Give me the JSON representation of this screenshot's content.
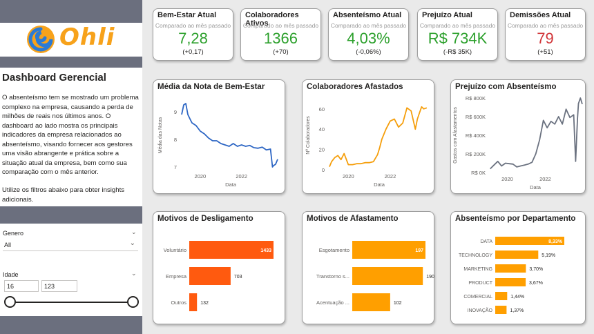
{
  "sidebar": {
    "logo_text": "Ohli",
    "title": "Dashboard Gerencial",
    "description": "O absenteísmo tem se mostrado um problema complexo na empresa, causando a perda de milhões de reais nos últimos anos. O dashboard ao lado mostra os principais indicadores da empresa relacionados ao absenteísmo, visando fornecer aos gestores uma visão abrangente e prática sobre a situação atual da empresa, bem como sua comparação com o mês anterior.",
    "hint": "Utilize os filtros abaixo para obter insights adicionais.",
    "colors": {
      "band": "#6b6f7e",
      "logo_orange": "#f7a21b",
      "logo_blue": "#2b7bd6"
    }
  },
  "filters": {
    "genero": {
      "label": "Genero",
      "value": "All"
    },
    "idade": {
      "label": "Idade",
      "min": "16",
      "max": "123"
    }
  },
  "kpis": [
    {
      "title": "Bem-Estar Atual",
      "subtitle": "Comparado ao mês passado",
      "value": "7,28",
      "delta": "(+0,17)",
      "color": "#2ca02c"
    },
    {
      "title": "Colaboradores Ativos",
      "subtitle": "Comparado ao mês passado",
      "value": "1366",
      "delta": "(+70)",
      "color": "#2ca02c"
    },
    {
      "title": "Absenteísmo Atual",
      "subtitle": "Comparado ao mês passado",
      "value": "4,03%",
      "delta": "(-0,06%)",
      "color": "#2ca02c"
    },
    {
      "title": "Prejuízo Atual",
      "subtitle": "Comparado ao mês passado",
      "value": "R$ 734K",
      "delta": "(-R$ 35K)",
      "color": "#2ca02c"
    },
    {
      "title": "Demissões Atual",
      "subtitle": "Comparado ao mês passado",
      "value": "79",
      "delta": "(+51)",
      "color": "#d13438"
    }
  ],
  "chart_data": [
    {
      "type": "line",
      "title": "Média da Nota de Bem-Estar",
      "xlabel": "Data",
      "ylabel": "Média das Notas",
      "color": "#2d66c4",
      "xlim": [
        2019.0,
        2023.95
      ],
      "ylim": [
        6.9,
        9.4
      ],
      "x_ticks": [
        2020,
        2022
      ],
      "y_ticks": [
        7,
        8,
        9
      ],
      "x": [
        2019.1,
        2019.2,
        2019.3,
        2019.4,
        2019.5,
        2019.6,
        2019.8,
        2020.0,
        2020.2,
        2020.4,
        2020.6,
        2020.8,
        2021.0,
        2021.2,
        2021.4,
        2021.6,
        2021.8,
        2022.0,
        2022.2,
        2022.4,
        2022.6,
        2022.8,
        2023.0,
        2023.2,
        2023.4,
        2023.5,
        2023.55,
        2023.65,
        2023.75
      ],
      "y": [
        8.9,
        9.25,
        9.3,
        8.9,
        8.75,
        8.6,
        8.5,
        8.3,
        8.2,
        8.05,
        7.95,
        7.95,
        7.85,
        7.8,
        7.75,
        7.85,
        7.75,
        7.8,
        7.75,
        7.78,
        7.7,
        7.68,
        7.72,
        7.62,
        7.65,
        7.0,
        7.05,
        7.1,
        7.28
      ]
    },
    {
      "type": "line",
      "title": "Colaboradores Afastados",
      "xlabel": "Data",
      "ylabel": "Nº Colaboradores",
      "color": "#f59e0b",
      "xlim": [
        2019.0,
        2023.95
      ],
      "ylim": [
        0,
        68
      ],
      "x_ticks": [
        2020,
        2022
      ],
      "y_ticks": [
        0,
        20,
        40,
        60
      ],
      "x": [
        2019.1,
        2019.2,
        2019.35,
        2019.5,
        2019.65,
        2019.8,
        2020.0,
        2020.2,
        2020.4,
        2020.6,
        2020.8,
        2021.0,
        2021.2,
        2021.4,
        2021.5,
        2021.6,
        2021.8,
        2022.0,
        2022.2,
        2022.4,
        2022.6,
        2022.8,
        2023.0,
        2023.2,
        2023.3,
        2023.4,
        2023.5,
        2023.6,
        2023.75
      ],
      "y": [
        3,
        8,
        12,
        14,
        10,
        16,
        5,
        5,
        6,
        6,
        7,
        7,
        8,
        15,
        22,
        30,
        40,
        48,
        50,
        42,
        46,
        61,
        58,
        40,
        50,
        56,
        62,
        60,
        61
      ]
    },
    {
      "type": "line",
      "title": "Prejuízo com Absenteísmo",
      "xlabel": "Data",
      "ylabel": "Gastos com Afastamentos",
      "color": "#6b7280",
      "xlim": [
        2019.0,
        2023.95
      ],
      "ylim": [
        0,
        800000
      ],
      "x_ticks": [
        2020,
        2022
      ],
      "y_ticks": [
        0,
        200000,
        400000,
        600000,
        800000
      ],
      "y_tick_labels": [
        "R$ 0K",
        "R$ 200K",
        "R$ 400K",
        "R$ 600K",
        "R$ 800K"
      ],
      "x": [
        2019.1,
        2019.3,
        2019.5,
        2019.7,
        2019.9,
        2020.1,
        2020.3,
        2020.5,
        2020.7,
        2020.9,
        2021.1,
        2021.3,
        2021.5,
        2021.7,
        2021.9,
        2022.1,
        2022.3,
        2022.5,
        2022.7,
        2022.9,
        2023.1,
        2023.3,
        2023.5,
        2023.6,
        2023.7,
        2023.75,
        2023.85,
        2023.95
      ],
      "y": [
        40000,
        80000,
        120000,
        70000,
        100000,
        95000,
        90000,
        60000,
        70000,
        80000,
        90000,
        110000,
        200000,
        350000,
        560000,
        480000,
        550000,
        520000,
        600000,
        520000,
        680000,
        590000,
        620000,
        120000,
        580000,
        740000,
        800000,
        734000
      ]
    },
    {
      "type": "bar",
      "orientation": "horizontal",
      "title": "Motivos de Desligamento",
      "color": "#ff5a0f",
      "categories": [
        "Voluntário",
        "Empresa",
        "Outros"
      ],
      "values": [
        1433,
        703,
        132
      ],
      "value_labels": [
        "1433",
        "703",
        "132"
      ]
    },
    {
      "type": "bar",
      "orientation": "horizontal",
      "title": "Motivos de Afastamento",
      "color": "#ff9f00",
      "categories": [
        "Esgotamento",
        "Transtorno s...",
        "Acentuação ..."
      ],
      "values": [
        197,
        190,
        102
      ],
      "value_labels": [
        "197",
        "190",
        "102"
      ]
    },
    {
      "type": "bar",
      "orientation": "horizontal",
      "title": "Absenteísmo por Departamento",
      "color": "#ff9f00",
      "categories": [
        "DATA",
        "TECHNOLOGY",
        "MARKETING",
        "PRODUCT",
        "COMERCIAL",
        "INOVAÇÃO"
      ],
      "values": [
        8.33,
        5.19,
        3.7,
        3.67,
        1.44,
        1.37
      ],
      "value_labels": [
        "8,33%",
        "5,19%",
        "3,70%",
        "3,67%",
        "1,44%",
        "1,37%"
      ]
    }
  ]
}
